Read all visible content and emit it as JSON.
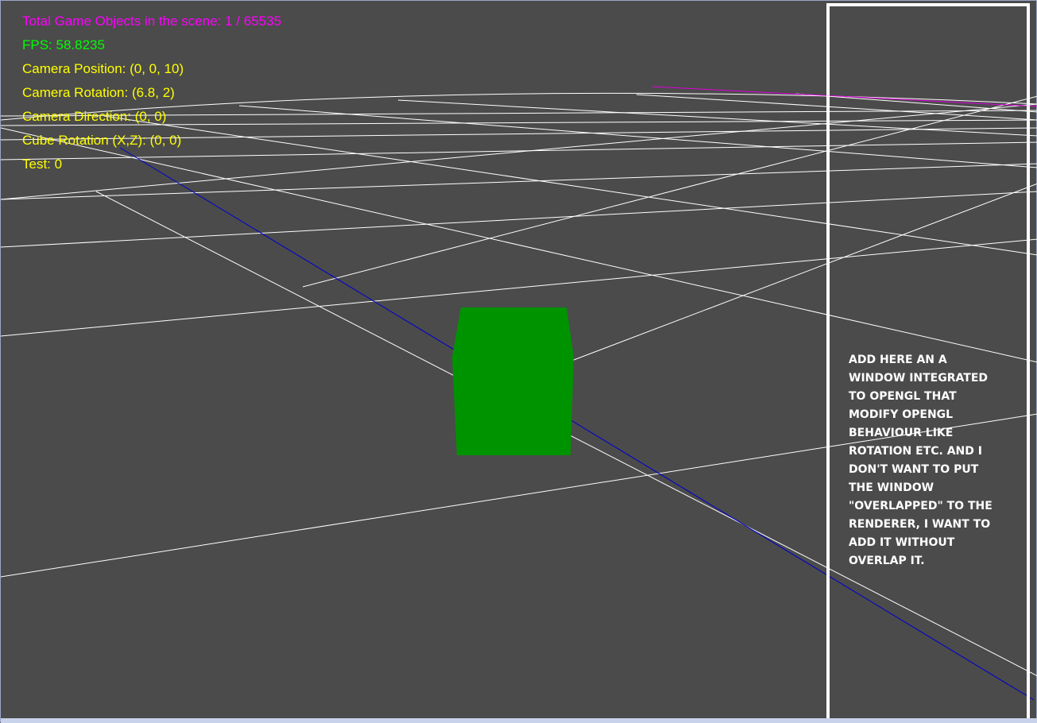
{
  "hud": {
    "total_objects": "Total Game Objects in the scene: 1 / 65535",
    "fps": "FPS: 58.8235",
    "camera_position": "Camera Position: (0, 0, 10)",
    "camera_rotation": "Camera Rotation: (6.8, 2)",
    "camera_direction": "Camera Direction: (0, 0)",
    "cube_rotation": "Cube Rotation (X,Z): (0, 0)",
    "test": "Test: 0"
  },
  "colors": {
    "background": "#4b4b4b",
    "grid": "#ffffff",
    "axis_x": "#e000e0",
    "axis_z": "#0000cc",
    "cube": "#009300",
    "hud_objects": "#ff00ff",
    "hud_fps": "#00ff00",
    "hud_text": "#ffff00"
  },
  "panel": {
    "note": "ADD HERE AN A\nWINDOW INTEGRATED\nTO OPENGL THAT\nMODIFY OPENGL\nBEHAVIOUR LIKE\nROTATION ETC. AND I\nDON'T WANT TO PUT\nTHE WINDOW\n\"OVERLAPPED\" TO THE\nRENDERER, I WANT TO\nADD IT WITHOUT\nOVERLAP IT."
  }
}
